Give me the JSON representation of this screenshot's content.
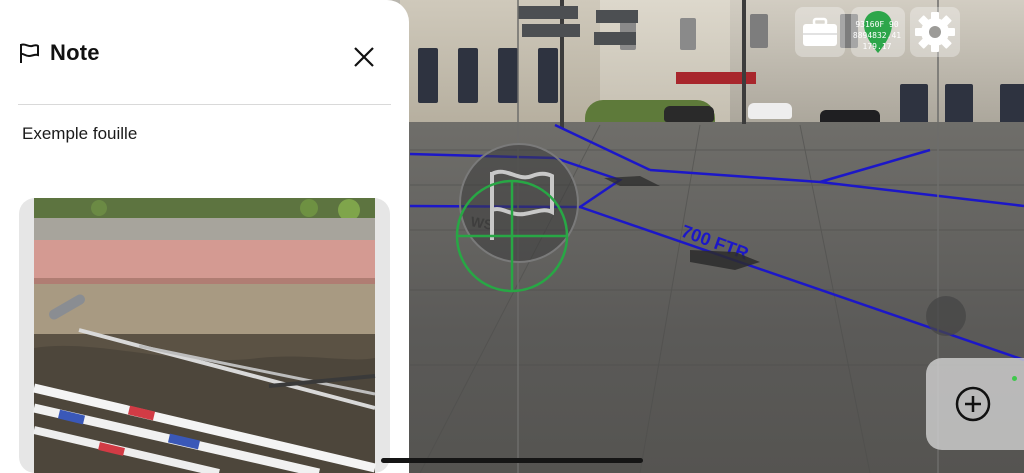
{
  "note_panel": {
    "title": "Note",
    "icon": "flag-icon",
    "close_icon": "close-icon",
    "description": "Exemple fouille",
    "photo_icon": "excavation-photo"
  },
  "toolbar": {
    "briefcase_icon": "briefcase-icon",
    "location": {
      "icon": "location-pin-icon",
      "x": "93160F 90",
      "y": "8894832.41",
      "z": "179.17"
    },
    "settings_icon": "gear-icon"
  },
  "ar_view": {
    "target_icon": "flag-icon",
    "crosshair_icon": "crosshair-icon",
    "network_label": "700 FTR",
    "network_label_2": "WS",
    "crosshair_color": "#28a745",
    "network_color": "#1c17c8"
  },
  "add_button": {
    "icon": "plus-circle-icon"
  },
  "status": {
    "indicator_color": "#3fc84c"
  }
}
